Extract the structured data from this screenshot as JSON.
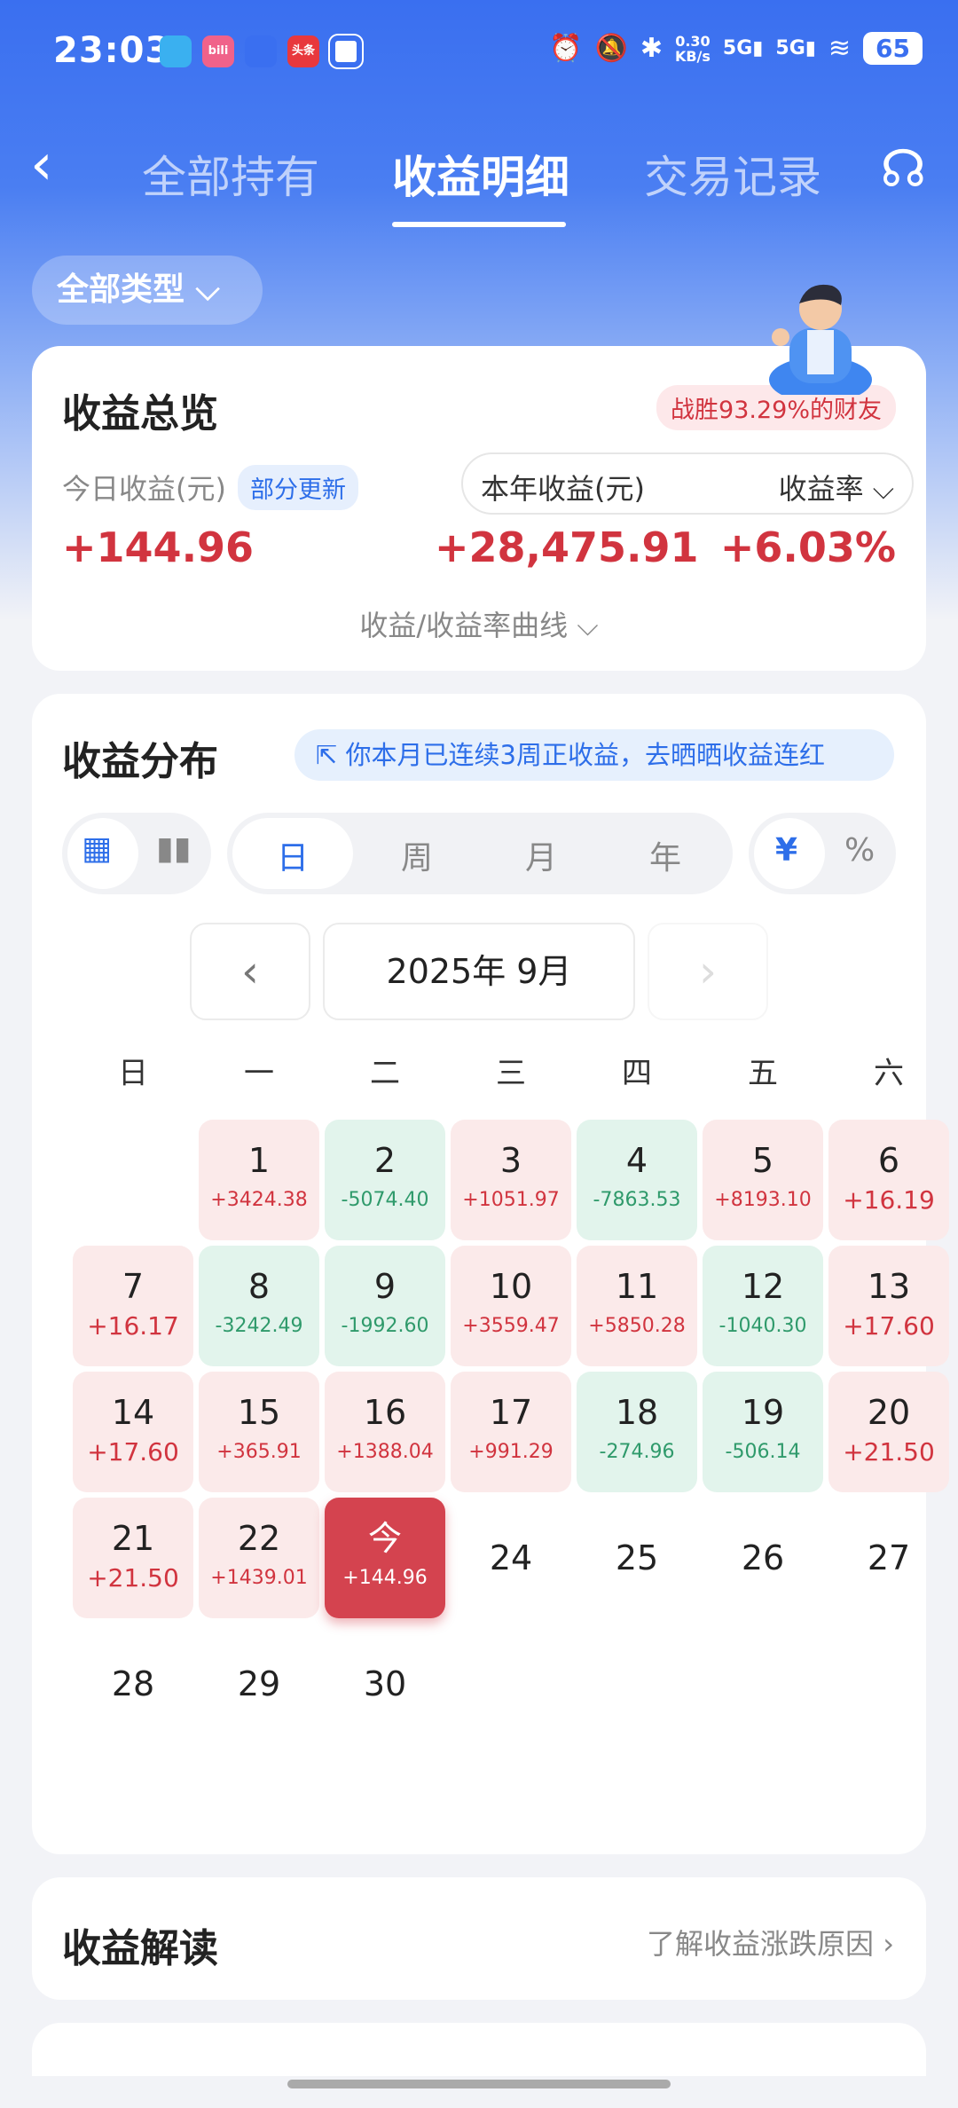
{
  "status": {
    "time": "23:03",
    "net_speed": "0.30\nKB/s",
    "signal1": "5G",
    "signal2": "5G",
    "battery": "65",
    "apps": [
      {
        "name": "app-icon-1",
        "color": "#3ab0f0",
        "text": ""
      },
      {
        "name": "bilibili-icon",
        "color": "#f0628a",
        "text": "bili"
      },
      {
        "name": "app-icon-3",
        "color": "#3a6ff0",
        "text": ""
      },
      {
        "name": "toutiao-icon",
        "color": "#e8383d",
        "text": "头条"
      },
      {
        "name": "app-icon-5",
        "color": "#ffffff",
        "text": ""
      }
    ]
  },
  "nav": {
    "tab1": "全部持有",
    "tab2": "收益明细",
    "tab3": "交易记录"
  },
  "filter": {
    "label": "全部类型 ⌵"
  },
  "overview": {
    "title": "收益总览",
    "rank": "战胜93.29%的财友",
    "today_label": "今日收益(元)",
    "partial": "部分更新",
    "year_label": "本年收益(元)",
    "rate_label": "收益率 ⌵",
    "today_value": "+144.96",
    "year_value": "+28,475.91",
    "rate_value": "+6.03%",
    "curve": "收益/收益率曲线 ⌵"
  },
  "dist": {
    "title": "收益分布",
    "share": "你本月已连续3周正收益，去晒晒收益连红",
    "seg_day": "日",
    "seg_week": "周",
    "seg_month": "月",
    "seg_year": "年",
    "seg_cny": "¥",
    "seg_pct": "%",
    "month": "2025年 9月",
    "weekdays": [
      "日",
      "一",
      "二",
      "三",
      "四",
      "五",
      "六"
    ]
  },
  "calendar": [
    {
      "d": "1",
      "v": "+3424.38",
      "t": "pos"
    },
    {
      "d": "2",
      "v": "-5074.40",
      "t": "neg"
    },
    {
      "d": "3",
      "v": "+1051.97",
      "t": "pos"
    },
    {
      "d": "4",
      "v": "-7863.53",
      "t": "neg"
    },
    {
      "d": "5",
      "v": "+8193.10",
      "t": "pos"
    },
    {
      "d": "6",
      "v": "+16.19",
      "t": "pos"
    },
    {
      "d": "7",
      "v": "+16.17",
      "t": "pos"
    },
    {
      "d": "8",
      "v": "-3242.49",
      "t": "neg"
    },
    {
      "d": "9",
      "v": "-1992.60",
      "t": "neg"
    },
    {
      "d": "10",
      "v": "+3559.47",
      "t": "pos"
    },
    {
      "d": "11",
      "v": "+5850.28",
      "t": "pos"
    },
    {
      "d": "12",
      "v": "-1040.30",
      "t": "neg"
    },
    {
      "d": "13",
      "v": "+17.60",
      "t": "pos"
    },
    {
      "d": "14",
      "v": "+17.60",
      "t": "pos"
    },
    {
      "d": "15",
      "v": "+365.91",
      "t": "pos"
    },
    {
      "d": "16",
      "v": "+1388.04",
      "t": "pos"
    },
    {
      "d": "17",
      "v": "+991.29",
      "t": "pos"
    },
    {
      "d": "18",
      "v": "-274.96",
      "t": "neg"
    },
    {
      "d": "19",
      "v": "-506.14",
      "t": "neg"
    },
    {
      "d": "20",
      "v": "+21.50",
      "t": "pos"
    },
    {
      "d": "21",
      "v": "+21.50",
      "t": "pos"
    },
    {
      "d": "22",
      "v": "+1439.01",
      "t": "pos"
    },
    {
      "d": "今",
      "v": "+144.96",
      "t": "today"
    },
    {
      "d": "24",
      "v": "",
      "t": "empty"
    },
    {
      "d": "25",
      "v": "",
      "t": "empty"
    },
    {
      "d": "26",
      "v": "",
      "t": "empty"
    },
    {
      "d": "27",
      "v": "",
      "t": "empty"
    },
    {
      "d": "28",
      "v": "",
      "t": "empty"
    },
    {
      "d": "29",
      "v": "",
      "t": "empty"
    },
    {
      "d": "30",
      "v": "",
      "t": "empty"
    }
  ],
  "interpret": {
    "title": "收益解读",
    "link": "了解收益涨跌原因 ›"
  }
}
